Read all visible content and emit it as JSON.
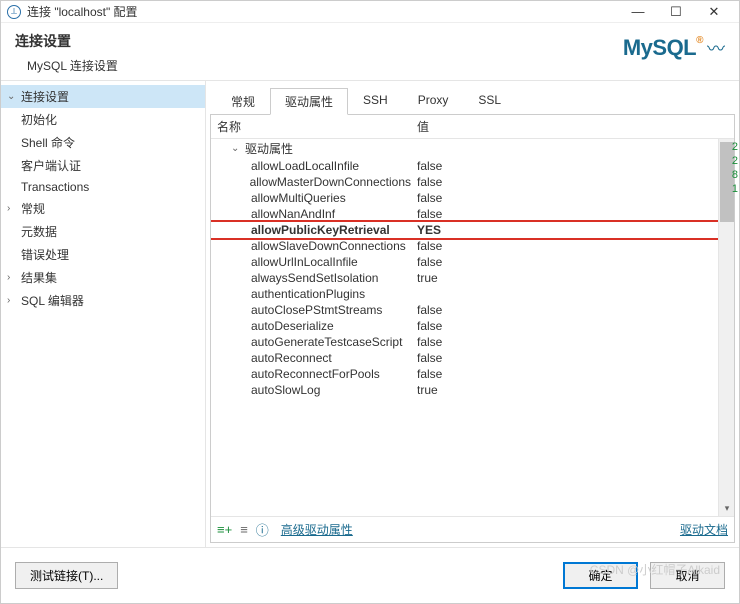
{
  "title": "连接 \"localhost\" 配置",
  "header": {
    "title": "连接设置",
    "subtitle": "MySQL 连接设置",
    "logo": "MySQL"
  },
  "sidebar": {
    "items": [
      {
        "label": "连接设置",
        "expanded": true,
        "selected": true,
        "children": [
          {
            "label": "初始化"
          },
          {
            "label": "Shell 命令"
          },
          {
            "label": "客户端认证"
          },
          {
            "label": "Transactions"
          }
        ]
      },
      {
        "label": "常规",
        "expanded": false,
        "children": [
          {
            "label": "元数据"
          },
          {
            "label": "错误处理"
          }
        ],
        "showChildren": true
      },
      {
        "label": "结果集",
        "expanded": false
      },
      {
        "label": "SQL 编辑器",
        "expanded": false
      }
    ]
  },
  "tabs": [
    {
      "label": "常规",
      "active": false
    },
    {
      "label": "驱动属性",
      "active": true
    },
    {
      "label": "SSH",
      "active": false
    },
    {
      "label": "Proxy",
      "active": false
    },
    {
      "label": "SSL",
      "active": false
    }
  ],
  "columns": {
    "name": "名称",
    "value": "值"
  },
  "group_label": "驱动属性",
  "props": [
    {
      "name": "allowLoadLocalInfile",
      "value": "false"
    },
    {
      "name": "allowMasterDownConnections",
      "value": "false"
    },
    {
      "name": "allowMultiQueries",
      "value": "false"
    },
    {
      "name": "allowNanAndInf",
      "value": "false"
    },
    {
      "name": "allowPublicKeyRetrieval",
      "value": "YES",
      "highlight": true
    },
    {
      "name": "allowSlaveDownConnections",
      "value": "false"
    },
    {
      "name": "allowUrlInLocalInfile",
      "value": "false"
    },
    {
      "name": "alwaysSendSetIsolation",
      "value": "true"
    },
    {
      "name": "authenticationPlugins",
      "value": ""
    },
    {
      "name": "autoClosePStmtStreams",
      "value": "false"
    },
    {
      "name": "autoDeserialize",
      "value": "false"
    },
    {
      "name": "autoGenerateTestcaseScript",
      "value": "false"
    },
    {
      "name": "autoReconnect",
      "value": "false"
    },
    {
      "name": "autoReconnectForPools",
      "value": "false"
    },
    {
      "name": "autoSlowLog",
      "value": "true"
    }
  ],
  "toolbar": {
    "info_label": "高级驱动属性",
    "doc_link": "驱动文档"
  },
  "side_markers": [
    "2",
    "2",
    "8",
    "1"
  ],
  "footer": {
    "test": "测试链接(T)...",
    "ok": "确定",
    "cancel": "取消"
  },
  "watermark": "CSDN @小红帽子Alkaid"
}
